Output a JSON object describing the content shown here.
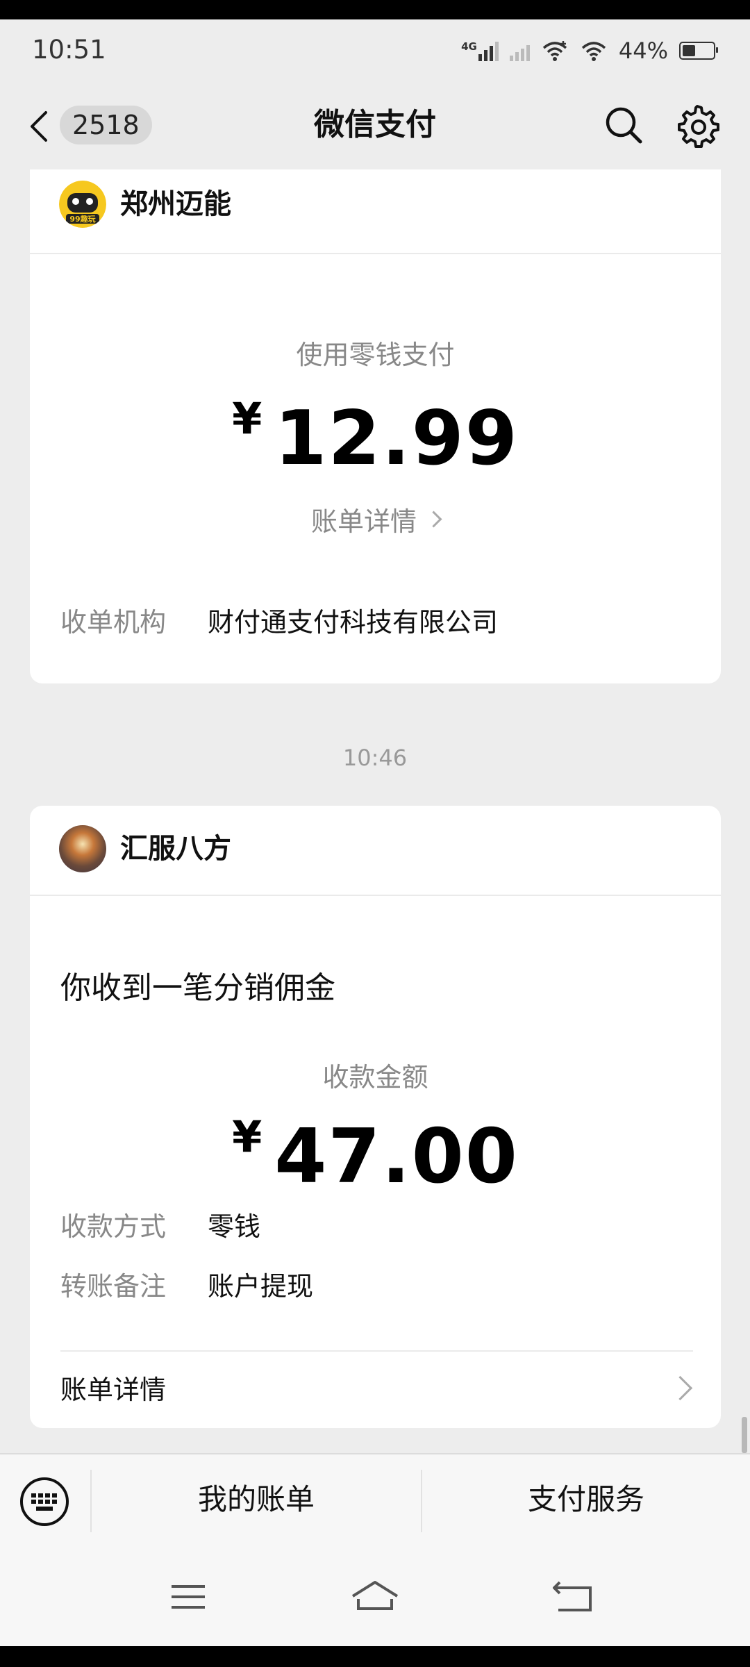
{
  "status_bar": {
    "time": "10:51",
    "network": "4G",
    "battery_percent": "44%",
    "battery_level": 0.44
  },
  "header": {
    "unread_count": "2518",
    "title": "微信支付"
  },
  "card1": {
    "merchant": "郑州迈能",
    "avatar_text": "99趣玩",
    "pay_method": "使用零钱支付",
    "currency": "¥",
    "amount": "12.99",
    "detail_link": "账单详情",
    "acquirer_label": "收单机构",
    "acquirer_value": "财付通支付科技有限公司"
  },
  "timestamp": "10:46",
  "card2": {
    "merchant": "汇服八方",
    "headline": "你收到一笔分销佣金",
    "amount_label": "收款金额",
    "currency": "¥",
    "amount": "47.00",
    "method_label": "收款方式",
    "method_value": "零钱",
    "note_label": "转账备注",
    "note_value": "账户提现",
    "detail_row": "账单详情"
  },
  "bottom_menu": {
    "my_bills": "我的账单",
    "pay_services": "支付服务"
  },
  "colors": {
    "background": "#ededed",
    "card": "#ffffff",
    "secondary_text": "#888888",
    "primary_text": "#111111"
  },
  "icons": {
    "back": "chevron-left-icon",
    "search": "search-icon",
    "settings": "gear-icon",
    "keyboard": "keyboard-icon",
    "nav_menu": "menu-icon",
    "nav_home": "home-icon",
    "nav_back": "back-icon"
  }
}
